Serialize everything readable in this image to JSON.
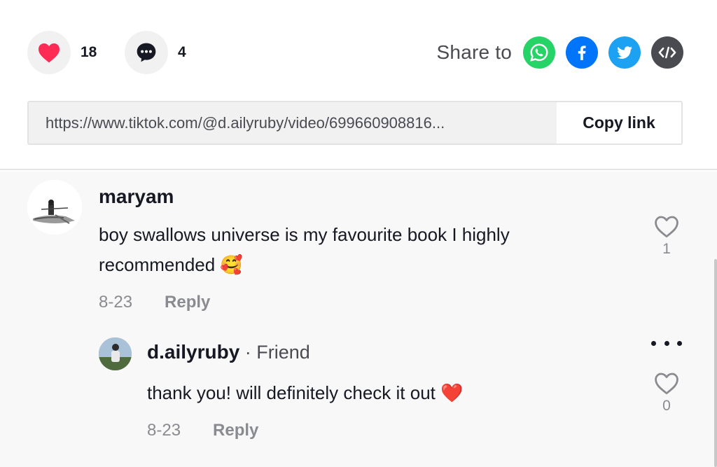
{
  "actions": {
    "likes": "18",
    "comments": "4"
  },
  "share": {
    "label": "Share to",
    "targets": [
      "whatsapp",
      "facebook",
      "twitter",
      "embed"
    ]
  },
  "link": {
    "url": "https://www.tiktok.com/@d.ailyruby/video/699660908816...",
    "copy_label": "Copy link"
  },
  "comment": {
    "username": "maryam",
    "text": "boy swallows universe is my favourite book I highly recommended 🥰",
    "date": "8-23",
    "reply_label": "Reply",
    "likes": "1"
  },
  "reply": {
    "username": "d.ailyruby",
    "badge": " · Friend",
    "text": "thank you! will definitely check it out ❤️",
    "date": "8-23",
    "reply_label": "Reply",
    "likes": "0"
  },
  "colors": {
    "like_red": "#fe2c55",
    "whatsapp": "#25d366",
    "facebook": "#0075fa",
    "twitter": "#1da1f2",
    "embed": "#4a4b51"
  }
}
